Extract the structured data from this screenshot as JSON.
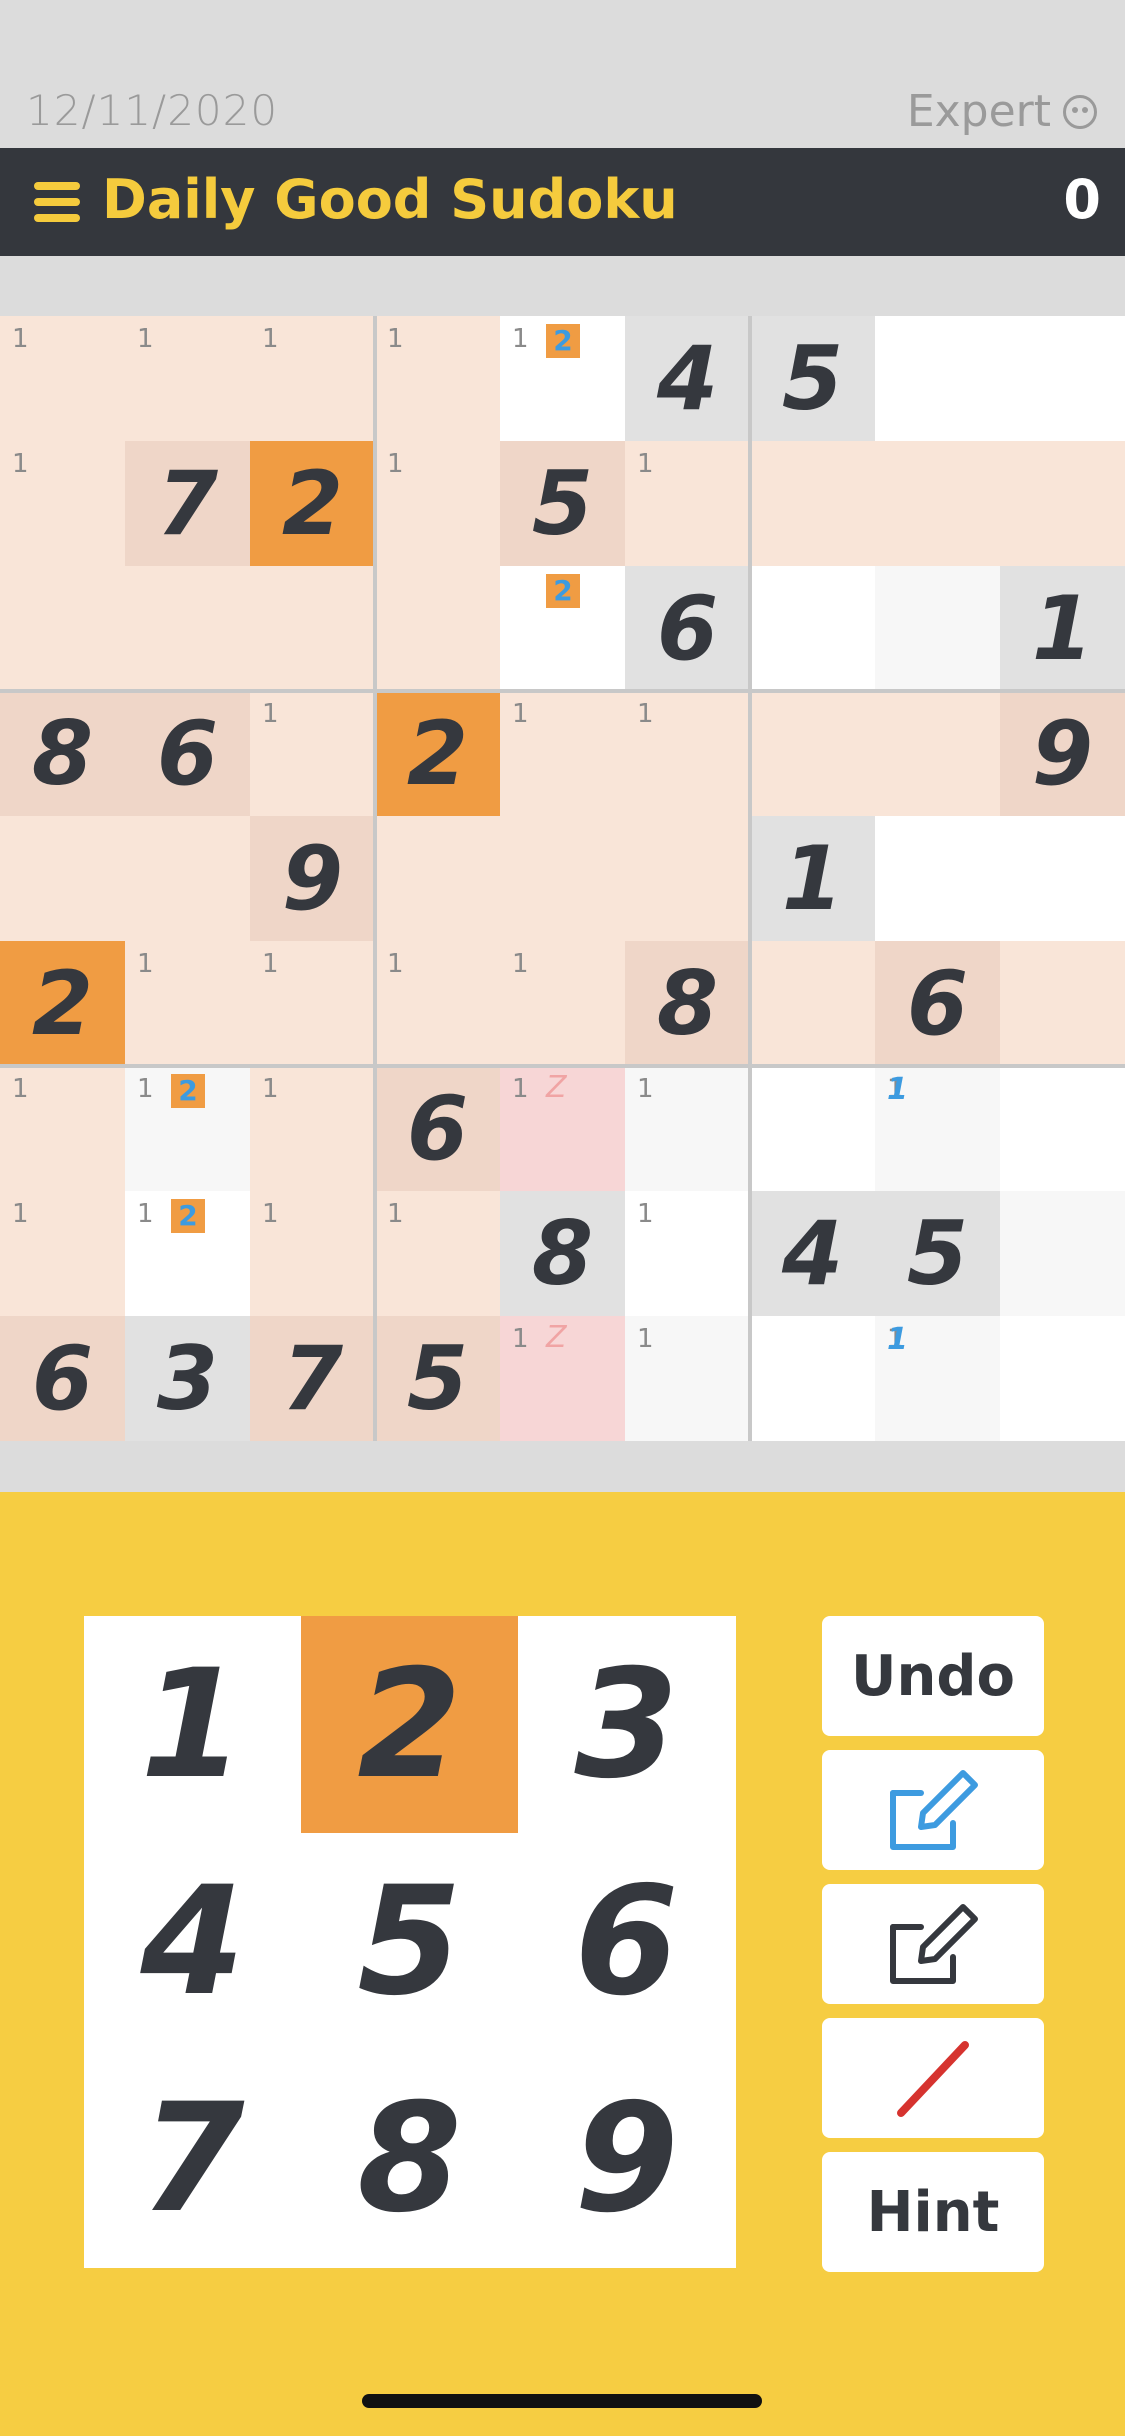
{
  "status": {
    "date": "12/11/2020",
    "difficulty": "Expert"
  },
  "header": {
    "title": "Daily Good Sudoku",
    "score": "0"
  },
  "colors": {
    "selected": "#f09c43",
    "highlight": "#f9e5d8",
    "related": "#efd6c8",
    "given_gray": "#e1e1e1",
    "conflict": "#f7d6d6",
    "empty": "#ffffff",
    "faint": "#f7f7f7",
    "accent_yellow": "#f6cd42"
  },
  "board": {
    "values": [
      [
        "",
        "",
        "",
        "",
        "",
        "4",
        "5",
        "",
        ""
      ],
      [
        "",
        "7",
        "2",
        "",
        "5",
        "",
        "",
        "",
        ""
      ],
      [
        "",
        "",
        "",
        "",
        "",
        "6",
        "",
        "",
        "1"
      ],
      [
        "8",
        "6",
        "",
        "2",
        "",
        "",
        "",
        "",
        "9"
      ],
      [
        "",
        "",
        "9",
        "",
        "",
        "",
        "1",
        "",
        ""
      ],
      [
        "2",
        "",
        "",
        "",
        "",
        "8",
        "",
        "6",
        ""
      ],
      [
        "",
        "",
        "",
        "6",
        "",
        "",
        "",
        "",
        ""
      ],
      [
        "",
        "",
        "",
        "",
        "8",
        "",
        "4",
        "5",
        ""
      ],
      [
        "6",
        "3",
        "7",
        "5",
        "",
        "",
        "",
        "",
        ""
      ]
    ],
    "bg": [
      [
        "H",
        "H",
        "H",
        "H",
        "W",
        "G",
        "G",
        "W",
        "W"
      ],
      [
        "H",
        "R",
        "S",
        "H",
        "R",
        "H",
        "H",
        "H",
        "H"
      ],
      [
        "H",
        "H",
        "H",
        "H",
        "W",
        "G",
        "W",
        "F",
        "G"
      ],
      [
        "R",
        "R",
        "H",
        "S",
        "H",
        "H",
        "H",
        "H",
        "R"
      ],
      [
        "H",
        "H",
        "R",
        "H",
        "H",
        "H",
        "G",
        "W",
        "W"
      ],
      [
        "S",
        "H",
        "H",
        "H",
        "H",
        "R",
        "H",
        "R",
        "H"
      ],
      [
        "H",
        "F",
        "H",
        "R",
        "C",
        "F",
        "W",
        "F",
        "W"
      ],
      [
        "H",
        "W",
        "H",
        "H",
        "G",
        "W",
        "G",
        "G",
        "F"
      ],
      [
        "R",
        "G",
        "R",
        "R",
        "C",
        "F",
        "W",
        "F",
        "W"
      ]
    ],
    "notes": [
      [
        "1",
        "1",
        "1",
        "1",
        "1",
        "",
        "",
        "",
        ""
      ],
      [
        "1",
        "",
        "",
        "1",
        "",
        "1",
        "",
        "",
        ""
      ],
      [
        "",
        "",
        "",
        "",
        "",
        "",
        "",
        "",
        ""
      ],
      [
        "",
        "",
        "1",
        "",
        "1",
        "1",
        "",
        "",
        ""
      ],
      [
        "",
        "",
        "",
        "",
        "",
        "",
        "",
        "",
        ""
      ],
      [
        "",
        "1",
        "1",
        "1",
        "1",
        "",
        "",
        "",
        ""
      ],
      [
        "1",
        "1",
        "1",
        "",
        "1",
        "1",
        "",
        "1",
        ""
      ],
      [
        "1",
        "1",
        "1",
        "1",
        "",
        "1",
        "",
        "",
        ""
      ],
      [
        "",
        "",
        "",
        "",
        "1",
        "1",
        "",
        "1",
        ""
      ]
    ],
    "note_boxes": [
      [
        "",
        "",
        "",
        "",
        "2",
        "",
        "",
        "",
        ""
      ],
      [
        "",
        "",
        "",
        "",
        "",
        "",
        "",
        "",
        ""
      ],
      [
        "",
        "",
        "",
        "",
        "2",
        "",
        "",
        "",
        ""
      ],
      [
        "",
        "",
        "",
        "",
        "",
        "",
        "",
        "",
        ""
      ],
      [
        "",
        "",
        "",
        "",
        "",
        "",
        "",
        "",
        ""
      ],
      [
        "",
        "",
        "",
        "",
        "",
        "",
        "",
        "",
        ""
      ],
      [
        "",
        "2",
        "",
        "",
        "",
        "",
        "",
        "",
        ""
      ],
      [
        "",
        "2",
        "",
        "",
        "",
        "",
        "",
        "",
        ""
      ],
      [
        "",
        "",
        "",
        "",
        "",
        "",
        "",
        "",
        ""
      ]
    ],
    "note_slashes": [
      [
        "",
        "",
        "",
        "",
        "",
        "",
        "",
        "",
        ""
      ],
      [
        "",
        "",
        "",
        "",
        "",
        "",
        "",
        "",
        ""
      ],
      [
        "",
        "",
        "",
        "",
        "",
        "",
        "",
        "",
        ""
      ],
      [
        "",
        "",
        "",
        "",
        "",
        "",
        "",
        "",
        ""
      ],
      [
        "",
        "",
        "",
        "",
        "",
        "",
        "",
        "",
        ""
      ],
      [
        "",
        "",
        "",
        "",
        "",
        "",
        "",
        "",
        ""
      ],
      [
        "",
        "",
        "",
        "",
        "Z",
        "",
        "",
        "",
        ""
      ],
      [
        "",
        "",
        "",
        "",
        "",
        "",
        "",
        "",
        ""
      ],
      [
        "",
        "",
        "",
        "",
        "Z",
        "",
        "",
        "",
        ""
      ]
    ],
    "note_blue": [
      [
        "",
        "",
        "",
        "",
        "",
        "",
        "",
        "",
        ""
      ],
      [
        "",
        "",
        "",
        "",
        "",
        "",
        "",
        "",
        ""
      ],
      [
        "",
        "",
        "",
        "",
        "",
        "",
        "",
        "",
        ""
      ],
      [
        "",
        "",
        "",
        "",
        "",
        "",
        "",
        "",
        ""
      ],
      [
        "",
        "",
        "",
        "",
        "",
        "",
        "",
        "",
        ""
      ],
      [
        "",
        "",
        "",
        "",
        "",
        "",
        "",
        "",
        ""
      ],
      [
        "",
        "",
        "",
        "",
        "",
        "",
        "",
        "1",
        ""
      ],
      [
        "",
        "",
        "",
        "",
        "",
        "",
        "",
        "",
        ""
      ],
      [
        "",
        "",
        "",
        "",
        "",
        "",
        "",
        "1",
        ""
      ]
    ]
  },
  "keypad": {
    "keys": [
      "1",
      "2",
      "3",
      "4",
      "5",
      "6",
      "7",
      "8",
      "9"
    ],
    "active": "2"
  },
  "controls": {
    "undo": "Undo",
    "hint": "Hint",
    "icons": [
      "pencil-edit-blue-icon",
      "pencil-edit-dark-icon",
      "slash-eraser-icon"
    ]
  }
}
